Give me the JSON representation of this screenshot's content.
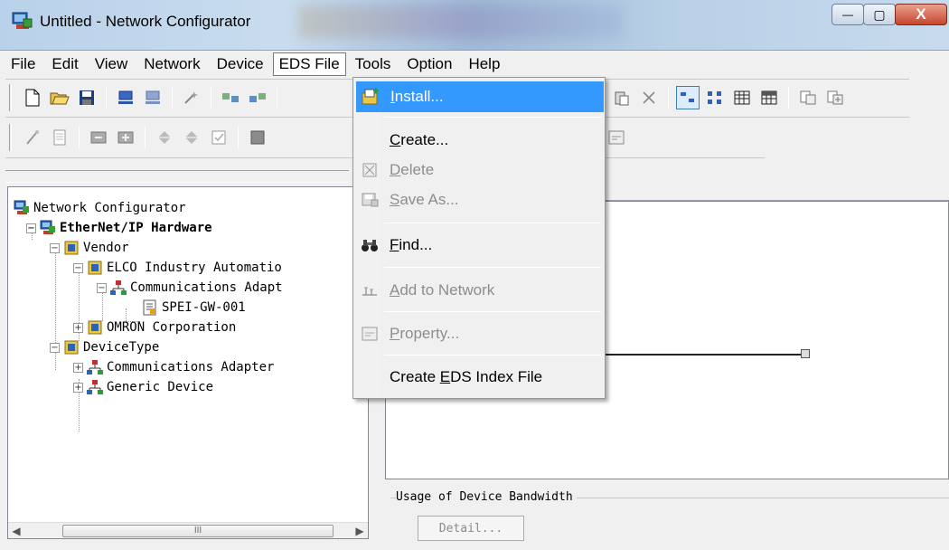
{
  "window": {
    "title": "Untitled - Network Configurator",
    "minimize_symbol": "—",
    "maximize_symbol": "▢",
    "close_symbol": "X"
  },
  "menubar": {
    "items": [
      "File",
      "Edit",
      "View",
      "Network",
      "Device",
      "EDS File",
      "Tools",
      "Option",
      "Help"
    ],
    "active": "EDS File"
  },
  "eds_menu": {
    "items": [
      {
        "label_pre": "",
        "accel": "I",
        "label_post": "nstall...",
        "icon": "install-icon",
        "state": "highlighted"
      },
      {
        "label_pre": "",
        "accel": "C",
        "label_post": "reate...",
        "icon": "",
        "state": "enabled"
      },
      {
        "label_pre": "",
        "accel": "D",
        "label_post": "elete",
        "icon": "delete-icon",
        "state": "disabled"
      },
      {
        "label_pre": "",
        "accel": "S",
        "label_post": "ave As...",
        "icon": "save-as-icon",
        "state": "disabled"
      },
      {
        "label_pre": "",
        "accel": "F",
        "label_post": "ind...",
        "icon": "binoculars-icon",
        "state": "enabled"
      },
      {
        "label_pre": "",
        "accel": "A",
        "label_post": "dd to Network",
        "icon": "add-to-network-icon",
        "state": "disabled"
      },
      {
        "label_pre": "",
        "accel": "P",
        "label_post": "roperty...",
        "icon": "property-icon",
        "state": "disabled"
      },
      {
        "label_pre": "Create ",
        "accel": "E",
        "label_post": "DS Index File",
        "icon": "",
        "state": "enabled"
      }
    ]
  },
  "tree": {
    "root": "Network Configurator",
    "hardware": "EtherNet/IP Hardware",
    "vendor": "Vendor",
    "vendor_elco": "ELCO Industry Automatio",
    "comm_adapter_child": "Communications Adapt",
    "device": "SPEI-GW-001",
    "vendor_omron": "OMRON Corporation",
    "device_type": "DeviceType",
    "dt_comm_adapter": "Communications Adapter",
    "dt_generic": "Generic Device",
    "scroll_thumb": "III"
  },
  "bandwidth": {
    "legend": "Usage of Device Bandwidth",
    "detail_button": "Detail..."
  },
  "colors": {
    "menu_highlight": "#3399ff",
    "disabled_text": "#8d8d8d"
  }
}
